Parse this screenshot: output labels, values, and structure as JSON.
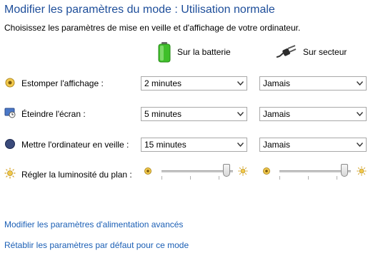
{
  "page": {
    "title": "Modifier les paramètres du mode : Utilisation normale",
    "subtitle": "Choisissez les paramètres de mise en veille et d'affichage de votre ordinateur."
  },
  "columns": {
    "battery_label": "Sur la batterie",
    "battery_icon": "battery-icon",
    "plugged_label": "Sur secteur",
    "plugged_icon": "power-plug-icon"
  },
  "settings": [
    {
      "label": "Estomper l'affichage :",
      "icon": "dim-display-icon",
      "battery_value": "2 minutes",
      "plugged_value": "Jamais"
    },
    {
      "label": "Éteindre l'écran :",
      "icon": "turn-off-display-icon",
      "battery_value": "5 minutes",
      "plugged_value": "Jamais"
    },
    {
      "label": "Mettre l'ordinateur en veille :",
      "icon": "sleep-icon",
      "battery_value": "15 minutes",
      "plugged_value": "Jamais"
    }
  ],
  "brightness": {
    "label": "Régler la luminosité du plan :",
    "icon": "brightness-sun-icon",
    "battery_level": 0.96,
    "plugged_level": 0.96
  },
  "links": {
    "advanced": "Modifier les paramètres d'alimentation avancés",
    "restore": "Rétablir les paramètres par défaut pour ce mode"
  },
  "colors": {
    "title": "#1e4e9a",
    "link": "#1b5fb5",
    "battery_green": "#3fbf2a"
  }
}
